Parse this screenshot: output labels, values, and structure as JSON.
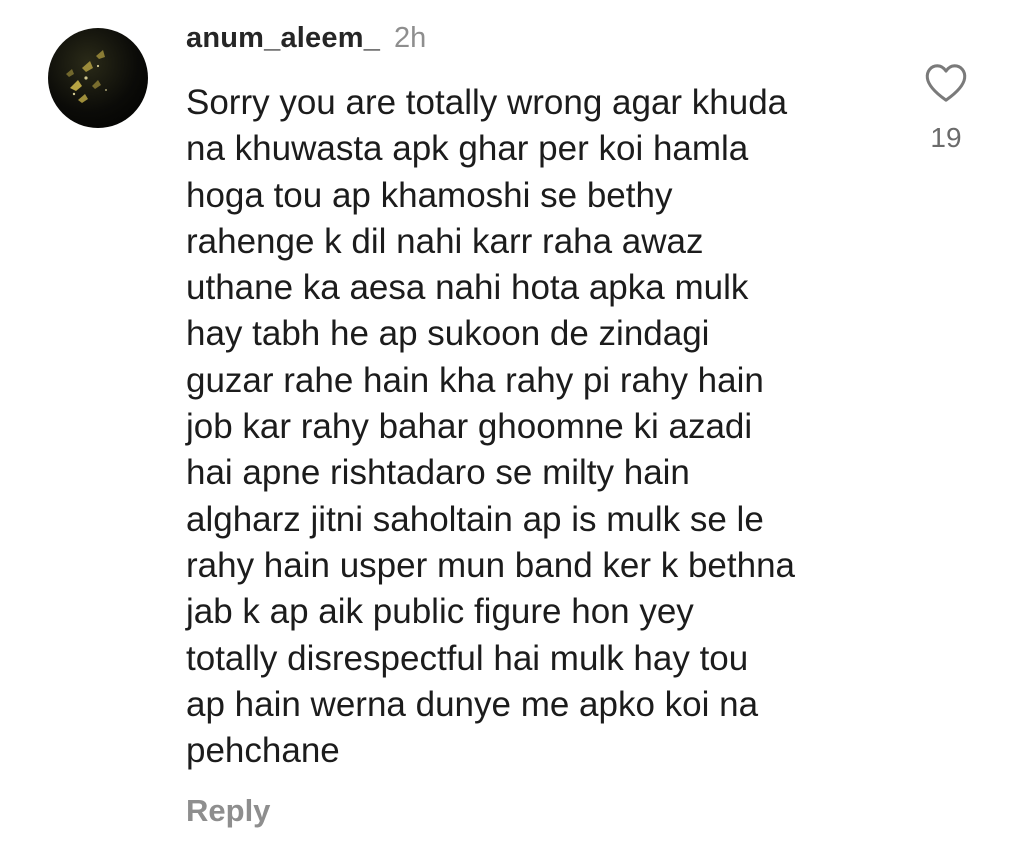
{
  "comment": {
    "username": "anum_aleem_",
    "timestamp": "2h",
    "lines": [
      "Sorry you are totally wrong agar khuda",
      "na khuwasta apk ghar per koi hamla",
      "hoga tou ap khamoshi se bethy",
      "rahenge k dil nahi karr raha awaz",
      "uthane ka aesa nahi hota apka mulk",
      "hay tabh he ap sukoon de zindagi",
      "guzar rahe hain kha rahy pi rahy hain",
      "job kar rahy bahar ghoomne ki azadi",
      "hai apne rishtadaro se milty hain",
      "algharz jitni saholtain ap is mulk se le",
      "rahy hain usper mun band ker k bethna",
      "jab k ap aik public figure hon yey",
      "totally disrespectful hai mulk hay tou",
      "ap hain werna dunye me apko koi na",
      "pehchane"
    ],
    "like_count": "19",
    "reply_label": "Reply",
    "like_icon": "heart-outline-icon",
    "avatar_icon": "butterflies-avatar"
  },
  "colors": {
    "username": "#262626",
    "secondary_text": "#8e8e8e",
    "body_text": "#1c1c1c",
    "avatar_bg": "#000000",
    "avatar_accent": "#c9b44a"
  }
}
